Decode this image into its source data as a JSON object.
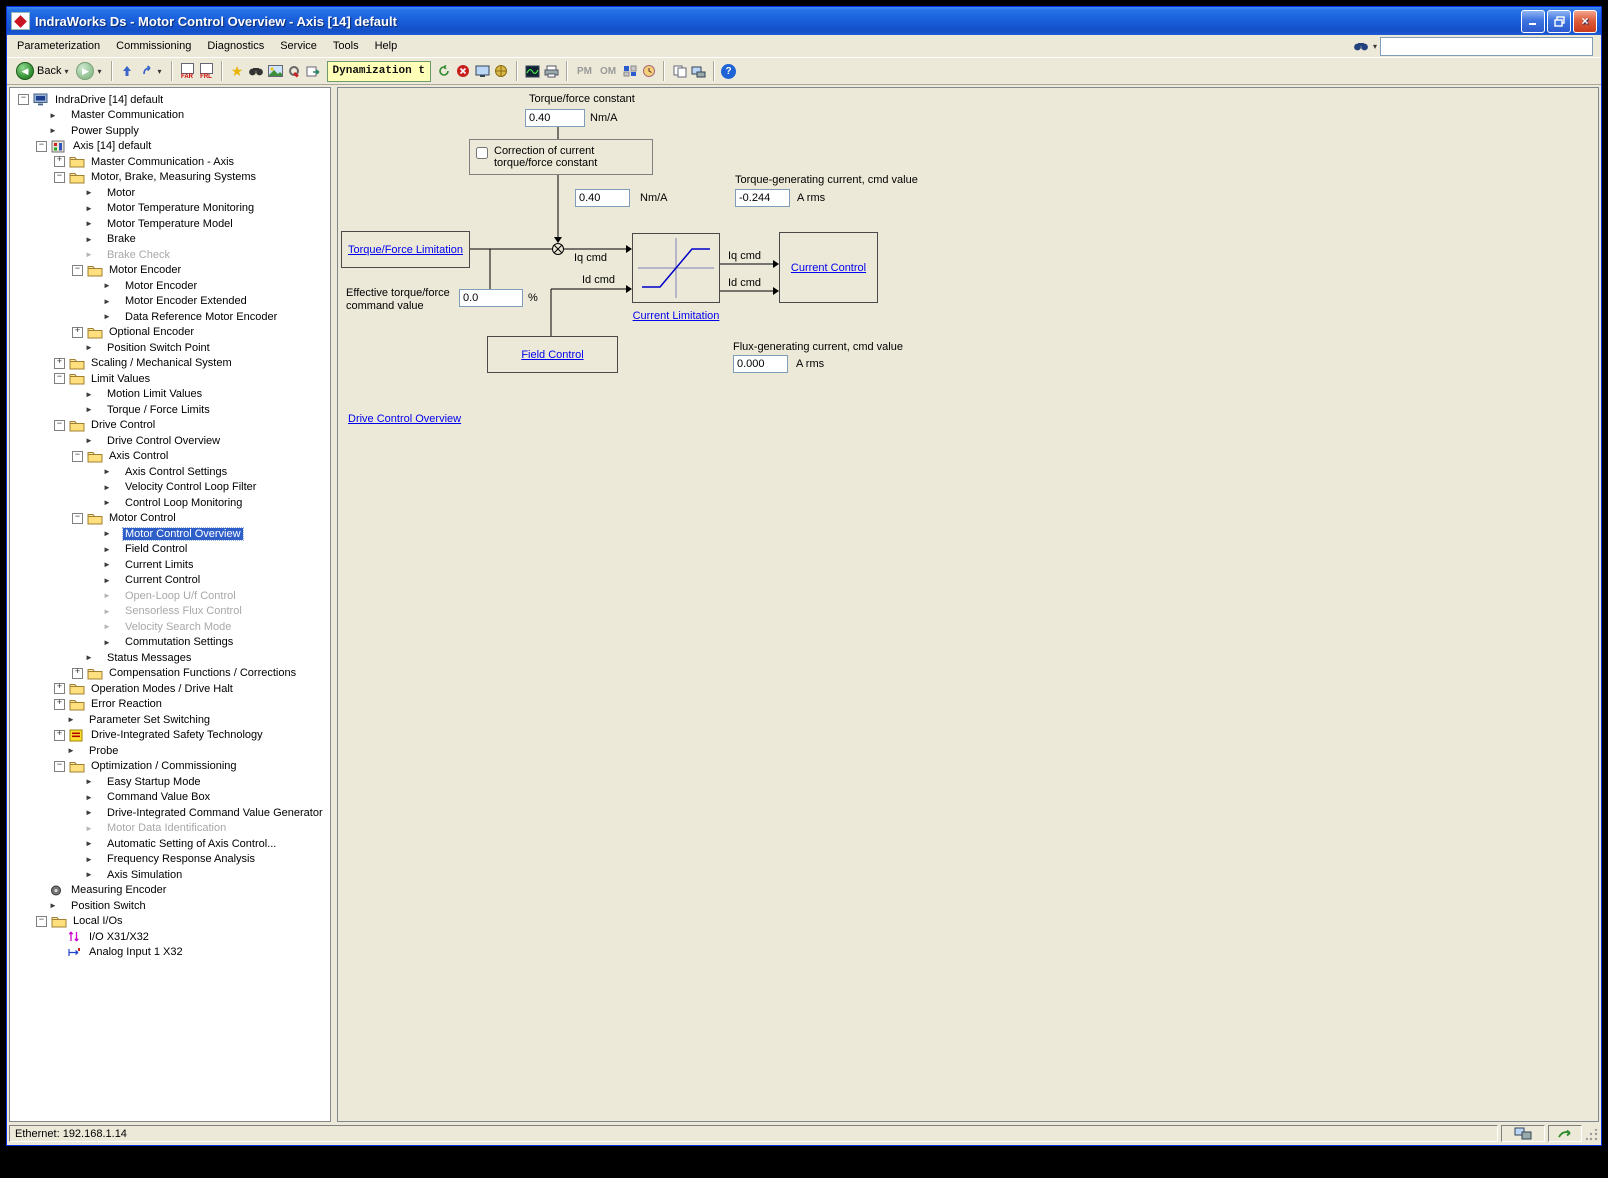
{
  "window": {
    "title": "IndraWorks Ds - Motor Control Overview - Axis [14] default"
  },
  "menu": {
    "items": [
      "Parameterization",
      "Commissioning",
      "Diagnostics",
      "Service",
      "Tools",
      "Help"
    ]
  },
  "toolbar": {
    "back": "Back",
    "far": "FAR",
    "frl": "FRL",
    "dynamization": "Dynamization t",
    "pm": "PM",
    "om": "OM"
  },
  "tree": {
    "items": [
      {
        "label": "IndraDrive [14] default",
        "level": 0,
        "icon": "drive",
        "expand": "minus"
      },
      {
        "label": "Master Communication",
        "level": 1,
        "icon": "page"
      },
      {
        "label": "Power Supply",
        "level": 1,
        "icon": "page"
      },
      {
        "label": "Axis [14] default",
        "level": 1,
        "icon": "axis",
        "expand": "minus"
      },
      {
        "label": "Master Communication - Axis",
        "level": 2,
        "icon": "folder",
        "expand": "plus"
      },
      {
        "label": "Motor, Brake, Measuring Systems",
        "level": 2,
        "icon": "folder",
        "expand": "minus"
      },
      {
        "label": "Motor",
        "level": 3,
        "icon": "page"
      },
      {
        "label": "Motor Temperature Monitoring",
        "level": 3,
        "icon": "page"
      },
      {
        "label": "Motor Temperature Model",
        "level": 3,
        "icon": "page"
      },
      {
        "label": "Brake",
        "level": 3,
        "icon": "page"
      },
      {
        "label": "Brake Check",
        "level": 3,
        "icon": "page",
        "gray": true
      },
      {
        "label": "Motor Encoder",
        "level": 3,
        "icon": "folder",
        "expand": "minus"
      },
      {
        "label": "Motor Encoder",
        "level": 4,
        "icon": "page"
      },
      {
        "label": "Motor Encoder Extended",
        "level": 4,
        "icon": "page"
      },
      {
        "label": "Data Reference Motor Encoder",
        "level": 4,
        "icon": "page"
      },
      {
        "label": "Optional Encoder",
        "level": 3,
        "icon": "folder",
        "expand": "plus"
      },
      {
        "label": "Position Switch Point",
        "level": 3,
        "icon": "page"
      },
      {
        "label": "Scaling / Mechanical System",
        "level": 2,
        "icon": "folder",
        "expand": "plus"
      },
      {
        "label": "Limit Values",
        "level": 2,
        "icon": "folder",
        "expand": "minus"
      },
      {
        "label": "Motion Limit Values",
        "level": 3,
        "icon": "page"
      },
      {
        "label": "Torque / Force Limits",
        "level": 3,
        "icon": "page"
      },
      {
        "label": "Drive Control",
        "level": 2,
        "icon": "folder",
        "expand": "minus"
      },
      {
        "label": "Drive Control Overview",
        "level": 3,
        "icon": "page"
      },
      {
        "label": "Axis Control",
        "level": 3,
        "icon": "folder",
        "expand": "minus"
      },
      {
        "label": "Axis Control Settings",
        "level": 4,
        "icon": "page"
      },
      {
        "label": "Velocity Control Loop Filter",
        "level": 4,
        "icon": "page"
      },
      {
        "label": "Control Loop Monitoring",
        "level": 4,
        "icon": "page"
      },
      {
        "label": "Motor Control",
        "level": 3,
        "icon": "folder",
        "expand": "minus"
      },
      {
        "label": "Motor Control Overview",
        "level": 4,
        "icon": "page",
        "selected": true
      },
      {
        "label": "Field Control",
        "level": 4,
        "icon": "page"
      },
      {
        "label": "Current Limits",
        "level": 4,
        "icon": "page"
      },
      {
        "label": "Current Control",
        "level": 4,
        "icon": "page"
      },
      {
        "label": "Open-Loop U/f Control",
        "level": 4,
        "icon": "page",
        "gray": true
      },
      {
        "label": "Sensorless Flux Control",
        "level": 4,
        "icon": "page",
        "gray": true
      },
      {
        "label": "Velocity Search Mode",
        "level": 4,
        "icon": "page",
        "gray": true
      },
      {
        "label": "Commutation Settings",
        "level": 4,
        "icon": "page"
      },
      {
        "label": "Status Messages",
        "level": 3,
        "icon": "page"
      },
      {
        "label": "Compensation Functions / Corrections",
        "level": 3,
        "icon": "folder",
        "expand": "plus"
      },
      {
        "label": "Operation Modes / Drive Halt",
        "level": 2,
        "icon": "folder",
        "expand": "plus"
      },
      {
        "label": "Error Reaction",
        "level": 2,
        "icon": "folder",
        "expand": "plus"
      },
      {
        "label": "Parameter Set Switching",
        "level": 2,
        "icon": "page"
      },
      {
        "label": "Drive-Integrated Safety Technology",
        "level": 2,
        "icon": "safety",
        "expand": "plus"
      },
      {
        "label": "Probe",
        "level": 2,
        "icon": "page"
      },
      {
        "label": "Optimization / Commissioning",
        "level": 2,
        "icon": "folder",
        "expand": "minus"
      },
      {
        "label": "Easy Startup Mode",
        "level": 3,
        "icon": "page"
      },
      {
        "label": "Command Value Box",
        "level": 3,
        "icon": "page"
      },
      {
        "label": "Drive-Integrated Command Value Generator",
        "level": 3,
        "icon": "page"
      },
      {
        "label": "Motor Data Identification",
        "level": 3,
        "icon": "page",
        "gray": true
      },
      {
        "label": "Automatic Setting of Axis Control...",
        "level": 3,
        "icon": "page"
      },
      {
        "label": "Frequency Response Analysis",
        "level": 3,
        "icon": "page"
      },
      {
        "label": "Axis Simulation",
        "level": 3,
        "icon": "page"
      },
      {
        "label": "Measuring Encoder",
        "level": 1,
        "icon": "encoder"
      },
      {
        "label": "Position Switch",
        "level": 1,
        "icon": "page"
      },
      {
        "label": "Local I/Os",
        "level": 1,
        "icon": "folder",
        "expand": "minus"
      },
      {
        "label": "I/O X31/X32",
        "level": 2,
        "icon": "io"
      },
      {
        "label": "Analog Input 1 X32",
        "level": 2,
        "icon": "analog"
      }
    ]
  },
  "diagram": {
    "torque_force_constant": {
      "label": "Torque/force constant",
      "value": "0.40",
      "unit": "Nm/A"
    },
    "correction": {
      "label": "Correction of current torque/force constant"
    },
    "corrected_constant": {
      "value": "0.40",
      "unit": "Nm/A"
    },
    "torque_gen": {
      "label": "Torque-generating current, cmd value",
      "value": "-0.244",
      "unit": "A rms"
    },
    "flux_gen": {
      "label": "Flux-generating current, cmd value",
      "value": "0.000",
      "unit": "A rms"
    },
    "effective": {
      "label_line1": "Effective torque/force",
      "label_line2": "command value",
      "value": "0.0",
      "unit": "%"
    },
    "links": {
      "torque_force_limitation": "Torque/Force Limitation",
      "current_limitation": "Current Limitation",
      "current_control": "Current Control",
      "field_control": "Field Control",
      "drive_control_overview": "Drive Control Overview"
    },
    "signals": {
      "iq_in": "Iq cmd",
      "id_in": "Id cmd",
      "iq_out": "Iq cmd",
      "id_out": "Id cmd"
    }
  },
  "statusbar": {
    "text": "Ethernet: 192.168.1.14"
  }
}
